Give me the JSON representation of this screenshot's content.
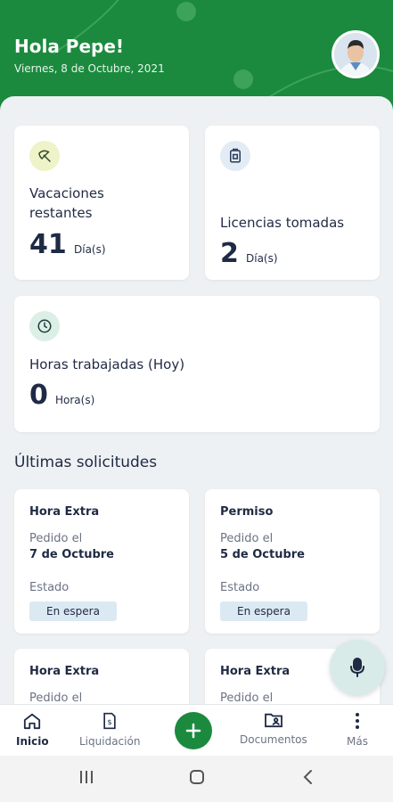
{
  "header": {
    "greeting": "Hola Pepe!",
    "date": "Viernes, 8 de Octubre, 2021"
  },
  "stats": {
    "vacations": {
      "title": "Vacaciones restantes",
      "value": "41",
      "unit": "Día(s)",
      "icon": "umbrella-icon"
    },
    "licenses": {
      "title": "Licencias tomadas",
      "value": "2",
      "unit": "Día(s)",
      "icon": "document-icon"
    },
    "hours": {
      "title": "Horas trabajadas (Hoy)",
      "value": "0",
      "unit": "Hora(s)",
      "icon": "clock-icon"
    }
  },
  "requests": {
    "section_title": "Últimas solicitudes",
    "items": [
      {
        "type": "Hora Extra",
        "requested_label": "Pedido el",
        "date": "7 de Octubre",
        "state_label": "Estado",
        "status": "En espera"
      },
      {
        "type": "Permiso",
        "requested_label": "Pedido el",
        "date": "5 de Octubre",
        "state_label": "Estado",
        "status": "En espera"
      },
      {
        "type": "Hora Extra",
        "requested_label": "Pedido el"
      },
      {
        "type": "Hora Extra",
        "requested_label": "Pedido el"
      }
    ]
  },
  "bottom_nav": {
    "items": [
      {
        "label": "Inicio",
        "icon": "home-icon",
        "active": true
      },
      {
        "label": "Liquidación",
        "icon": "receipt-icon"
      },
      {
        "label": "Documentos",
        "icon": "folder-icon"
      },
      {
        "label": "Más",
        "icon": "more-vertical-icon"
      }
    ],
    "add_icon": "plus-icon"
  },
  "colors": {
    "brand_green": "#1b8a3e",
    "background": "#eef1f3",
    "badge_bg": "#dbe9f3",
    "mic_fab_bg": "#d8ebe9"
  }
}
